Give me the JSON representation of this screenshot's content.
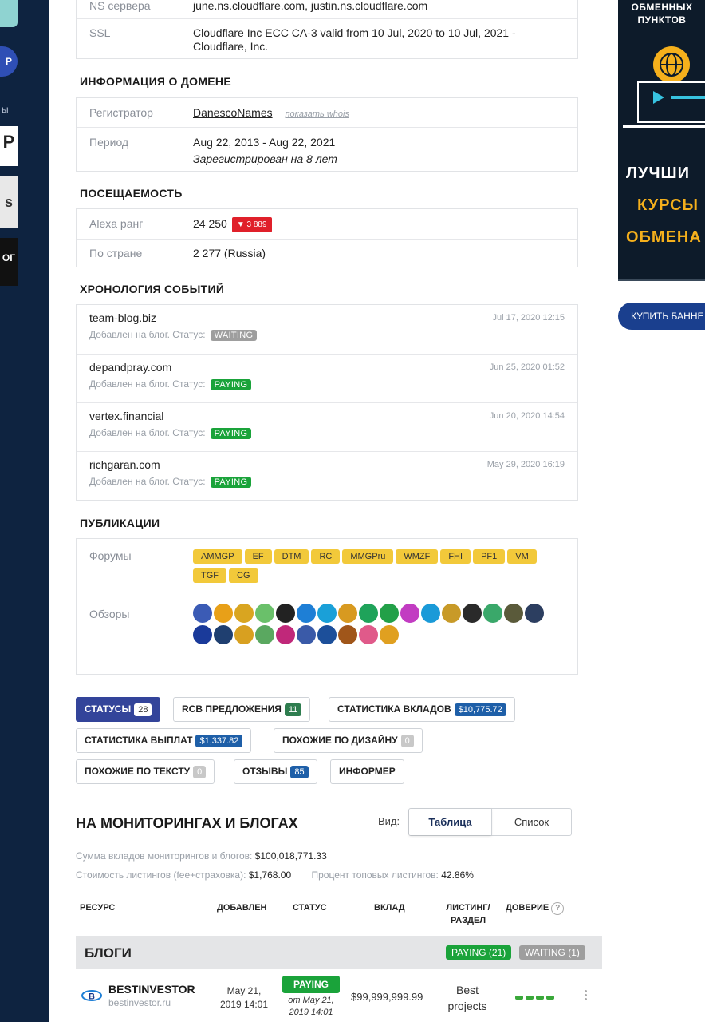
{
  "left_rail": {
    "pill_text": "P",
    "side_text": "ы",
    "logo1_text": "P",
    "logo2_text": "s",
    "logo3_text": "ОГ"
  },
  "server_info": {
    "rows": [
      {
        "key": "NS сервера",
        "value": "june.ns.cloudflare.com, justin.ns.cloudflare.com"
      },
      {
        "key": "SSL",
        "value": "Cloudflare Inc ECC CA-3 valid from 10 Jul, 2020 to 10 Jul, 2021 - Cloudflare, Inc."
      }
    ]
  },
  "domain_info": {
    "title": "ИНФОРМАЦИЯ О ДОМЕНЕ",
    "registrar_key": "Регистратор",
    "registrar_value": "DanescoNames",
    "whois_link": "показать whois",
    "period_key": "Период",
    "period_value": "Aug 22, 2013 - Aug 22, 2021",
    "period_sub": "Зарегистрирован на 8 лет"
  },
  "traffic": {
    "title": "ПОСЕЩАЕМОСТЬ",
    "alexa_key": "Alexa ранг",
    "alexa_value": "24 250",
    "alexa_change": "▼ 3 889",
    "country_key": "По стране",
    "country_value": "2 277 (Russia)"
  },
  "timeline": {
    "title": "ХРОНОЛОГИЯ СОБЫТИЙ",
    "events": [
      {
        "name": "team-blog.biz",
        "desc": "Добавлен на блог. Статус:",
        "status": "WAITING",
        "date": "Jul 17, 2020 12:15"
      },
      {
        "name": "depandpray.com",
        "desc": "Добавлен на блог. Статус:",
        "status": "PAYING",
        "date": "Jun 25, 2020 01:52"
      },
      {
        "name": "vertex.financial",
        "desc": "Добавлен на блог. Статус:",
        "status": "PAYING",
        "date": "Jun 20, 2020 14:54"
      },
      {
        "name": "richgaran.com",
        "desc": "Добавлен на блог. Статус:",
        "status": "PAYING",
        "date": "May 29, 2020 16:19"
      }
    ]
  },
  "publications": {
    "title": "ПУБЛИКАЦИИ",
    "forums_key": "Форумы",
    "forums": [
      "AMMGP",
      "EF",
      "DTM",
      "RC",
      "MMGPru",
      "WMZF",
      "FHI",
      "PF1",
      "VM",
      "TGF",
      "CG"
    ],
    "reviews_key": "Обзоры",
    "review_icon_colors": [
      "#3b5bb5",
      "#e8a018",
      "#d9a520",
      "#6ac06a",
      "#222222",
      "#1e7fd6",
      "#1aa0d8",
      "#d89a20",
      "#1fa35a",
      "#22a048",
      "#c23cc2",
      "#1a9ad8",
      "#c89a28",
      "#2a2a2a",
      "#3aa86a",
      "#5a5a3a",
      "#2c3e60",
      "#1a3a9a",
      "#1f3f70",
      "#d8a020",
      "#5aa860",
      "#c0287a",
      "#3a5aa8",
      "#1c4f9a",
      "#a0561a",
      "#e05a8a",
      "#e0a020"
    ]
  },
  "tabs": [
    {
      "label": "СТАТУСЫ",
      "count": "28",
      "style": "white",
      "active": true
    },
    {
      "label": "RCB ПРЕДЛОЖЕНИЯ",
      "count": "11",
      "style": "green",
      "active": false
    },
    {
      "label": "СТАТИСТИКА ВКЛАДОВ",
      "count": "$10,775.72",
      "style": "blue",
      "active": false
    },
    {
      "label": "СТАТИСТИКА ВЫПЛАТ",
      "count": "$1,337.82",
      "style": "blue",
      "active": false
    },
    {
      "label": "ПОХОЖИЕ ПО ДИЗАЙНУ",
      "count": "0",
      "style": "gray",
      "active": false
    },
    {
      "label": "ПОХОЖИЕ ПО ТЕКСТУ",
      "count": "0",
      "style": "gray",
      "active": false
    },
    {
      "label": "ОТЗЫВЫ",
      "count": "85",
      "style": "blue",
      "active": false
    },
    {
      "label": "ИНФОРМЕР",
      "count": "",
      "style": "none",
      "active": false
    }
  ],
  "monitoring": {
    "title": "НА МОНИТОРИНГАХ И БЛОГАХ",
    "view_label": "Вид:",
    "view_table": "Таблица",
    "view_list": "Список",
    "sum_label": "Сумма вкладов мониторингов и блогов:",
    "sum_value": "$100,018,771.33",
    "cost_label": "Стоимость листингов (fee+страховка):",
    "cost_value": "$1,768.00",
    "pct_label": "Процент топовых листингов:",
    "pct_value": "42.86%",
    "headers": {
      "resource": "РЕСУРС",
      "added": "ДОБАВЛЕН",
      "status": "СТАТУС",
      "deposit": "ВКЛАД",
      "listing": "ЛИСТИНГ/ РАЗДЕЛ",
      "trust": "ДОВЕРИЕ",
      "trust_help": "?"
    },
    "group": {
      "title": "БЛОГИ",
      "paying": "PAYING (21)",
      "waiting": "WAITING (1)"
    },
    "row": {
      "name": "BESTINVESTOR",
      "domain": "bestinvestor.ru",
      "added": "May 21, 2019 14:01",
      "status": "PAYING",
      "status_since": "от May 21, 2019 14:01",
      "deposit": "$99,999,999.99",
      "listing": "Best projects",
      "trust_level": 4,
      "trust_max": 4
    }
  },
  "ad": {
    "top_text": "ОБМЕННЫХ ПУНКТОВ",
    "line1": "ЛУЧШИ",
    "line2": "КУРСЫ",
    "line3": "ОБМЕНА",
    "buy_button": "КУПИТЬ БАННЕ",
    "accent": "#f5b01c"
  }
}
